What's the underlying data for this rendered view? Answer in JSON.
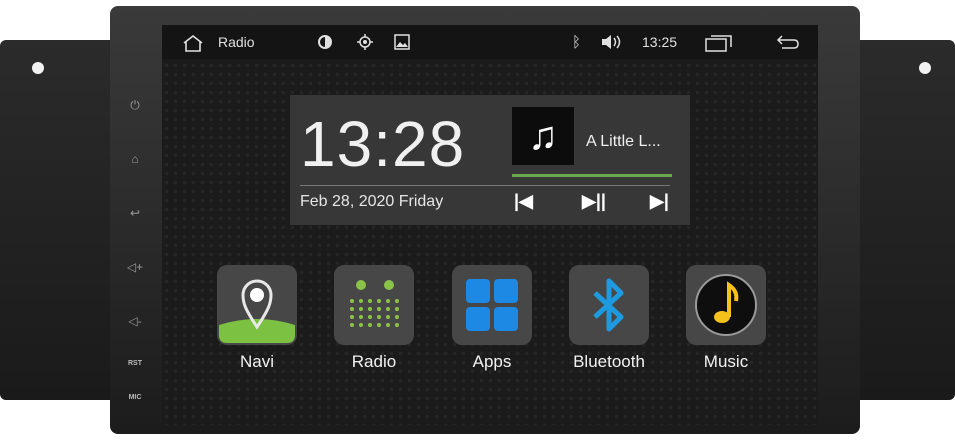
{
  "statusbar": {
    "home_icon": "home-icon",
    "title": "Radio",
    "brightness_icon": "brightness-icon",
    "gps_icon": "gps-icon",
    "gallery_icon": "gallery-icon",
    "bluetooth_icon": "bluetooth-icon",
    "volume_icon": "volume-icon",
    "time": "13:25",
    "windows_icon": "recent-windows-icon",
    "back_icon": "back-icon"
  },
  "side_panel": {
    "labels": {
      "rst": "RST",
      "mic": "MIC"
    },
    "icons": [
      "power-icon",
      "home-icon",
      "back-icon",
      "volume-up-icon",
      "volume-down-icon"
    ]
  },
  "widget": {
    "clock": "13:28",
    "date": "Feb 28, 2020 Friday",
    "track": "A Little L...",
    "album_icon": "music-note-icon",
    "controls": {
      "prev": "|◀",
      "play_pause": "▶||",
      "next": "▶|"
    }
  },
  "apps": [
    {
      "label": "Navi",
      "icon": "navi-icon"
    },
    {
      "label": "Radio",
      "icon": "radio-icon"
    },
    {
      "label": "Apps",
      "icon": "apps-icon"
    },
    {
      "label": "Bluetooth",
      "icon": "bluetooth-icon"
    },
    {
      "label": "Music",
      "icon": "music-icon"
    }
  ],
  "colors": {
    "navi_green": "#7cc142",
    "radio_green": "#8bc34a",
    "apps_blue": "#1e88e5",
    "bluetooth_blue": "#1e9be0",
    "music_yellow": "#f5c21b"
  }
}
